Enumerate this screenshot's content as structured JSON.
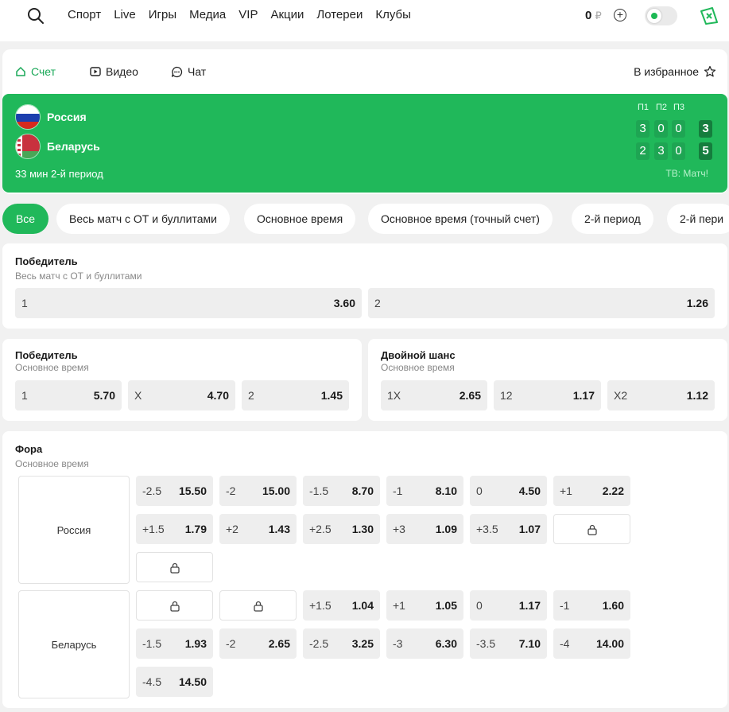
{
  "nav": {
    "links": [
      "Спорт",
      "Live",
      "Игры",
      "Медиа",
      "VIP",
      "Акции",
      "Лотереи",
      "Клубы"
    ],
    "balance": "0",
    "currency": "₽"
  },
  "tabs": {
    "score": "Счет",
    "video": "Видео",
    "chat": "Чат",
    "favorite": "В избранное"
  },
  "match": {
    "team1": "Россия",
    "team2": "Беларусь",
    "status": "33 мин 2-й период",
    "periods": [
      "П1",
      "П2",
      "П3"
    ],
    "team1_scores": [
      "3",
      "0",
      "0"
    ],
    "team1_total": "3",
    "team2_scores": [
      "2",
      "3",
      "0"
    ],
    "team2_total": "5",
    "tv": "ТВ: Матч!"
  },
  "filters": [
    "Все",
    "Весь матч с ОТ и буллитами",
    "Основное время",
    "Основное время (точный счет)",
    "2-й период",
    "2-й пери"
  ],
  "winner_full": {
    "title": "Победитель",
    "subtitle": "Весь матч с ОТ и буллитами",
    "odds": [
      {
        "label": "1",
        "value": "3.60"
      },
      {
        "label": "2",
        "value": "1.26"
      }
    ]
  },
  "winner_regular": {
    "title": "Победитель",
    "subtitle": "Основное время",
    "odds": [
      {
        "label": "1",
        "value": "5.70"
      },
      {
        "label": "X",
        "value": "4.70"
      },
      {
        "label": "2",
        "value": "1.45"
      }
    ]
  },
  "double_chance": {
    "title": "Двойной шанс",
    "subtitle": "Основное время",
    "odds": [
      {
        "label": "1X",
        "value": "2.65"
      },
      {
        "label": "12",
        "value": "1.17"
      },
      {
        "label": "X2",
        "value": "1.12"
      }
    ]
  },
  "handicap": {
    "title": "Фора",
    "subtitle": "Основное время",
    "team1": "Россия",
    "team2": "Беларусь",
    "team1_odds": [
      {
        "label": "-2.5",
        "value": "15.50"
      },
      {
        "label": "-2",
        "value": "15.00"
      },
      {
        "label": "-1.5",
        "value": "8.70"
      },
      {
        "label": "-1",
        "value": "8.10"
      },
      {
        "label": "0",
        "value": "4.50"
      },
      {
        "label": "+1",
        "value": "2.22"
      },
      {
        "label": "+1.5",
        "value": "1.79"
      },
      {
        "label": "+2",
        "value": "1.43"
      },
      {
        "label": "+2.5",
        "value": "1.30"
      },
      {
        "label": "+3",
        "value": "1.09"
      },
      {
        "label": "+3.5",
        "value": "1.07"
      }
    ],
    "team2_odds": [
      {
        "label": "+1.5",
        "value": "1.04"
      },
      {
        "label": "+1",
        "value": "1.05"
      },
      {
        "label": "0",
        "value": "1.17"
      },
      {
        "label": "-1",
        "value": "1.60"
      },
      {
        "label": "-1.5",
        "value": "1.93"
      },
      {
        "label": "-2",
        "value": "2.65"
      },
      {
        "label": "-2.5",
        "value": "3.25"
      },
      {
        "label": "-3",
        "value": "6.30"
      },
      {
        "label": "-3.5",
        "value": "7.10"
      },
      {
        "label": "-4",
        "value": "14.00"
      },
      {
        "label": "-4.5",
        "value": "14.50"
      }
    ]
  }
}
